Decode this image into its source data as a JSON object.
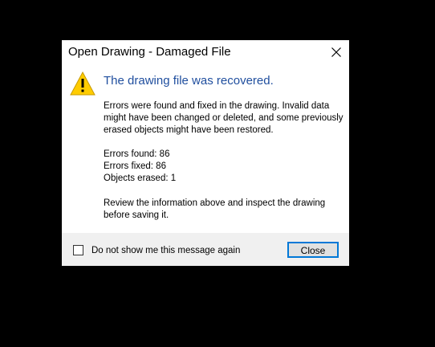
{
  "dialog": {
    "title": "Open Drawing - Damaged File",
    "close_icon": "close-icon",
    "warning_icon": "warning-triangle-icon",
    "heading": "The drawing file was recovered.",
    "description": "Errors were found and fixed in the drawing. Invalid data might have been changed or deleted, and some previously erased objects might have been restored.",
    "stats": {
      "errors_found": "Errors found:  86",
      "errors_fixed": "Errors fixed:  86",
      "objects_erased": "Objects erased:  1"
    },
    "advice": "Review the information above and inspect the drawing before saving it.",
    "checkbox_label": "Do not show me this message again",
    "checkbox_checked": false,
    "close_button_label": "Close"
  },
  "colors": {
    "heading": "#1f4e9e",
    "warning_fill": "#ffcc00",
    "button_focus_border": "#0078d7",
    "footer_bg": "#f0f0f0",
    "background": "#000000"
  }
}
